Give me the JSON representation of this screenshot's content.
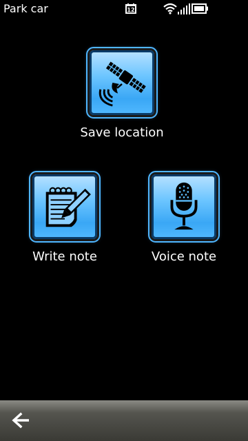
{
  "statusbar": {
    "app_title": "Park car",
    "calendar_day": "12",
    "icons": [
      "calendar-icon",
      "wifi-icon",
      "signal-icon",
      "battery-icon"
    ]
  },
  "actions": {
    "save_location": {
      "label": "Save location",
      "icon": "satellite-icon"
    },
    "write_note": {
      "label": "Write note",
      "icon": "notepad-pencil-icon"
    },
    "voice_note": {
      "label": "Voice note",
      "icon": "microphone-icon"
    }
  },
  "toolbar": {
    "back_icon": "back-arrow-icon"
  },
  "colors": {
    "background": "#000000",
    "tile_accent": "#4fb6ff",
    "toolbar": "#55554f"
  }
}
